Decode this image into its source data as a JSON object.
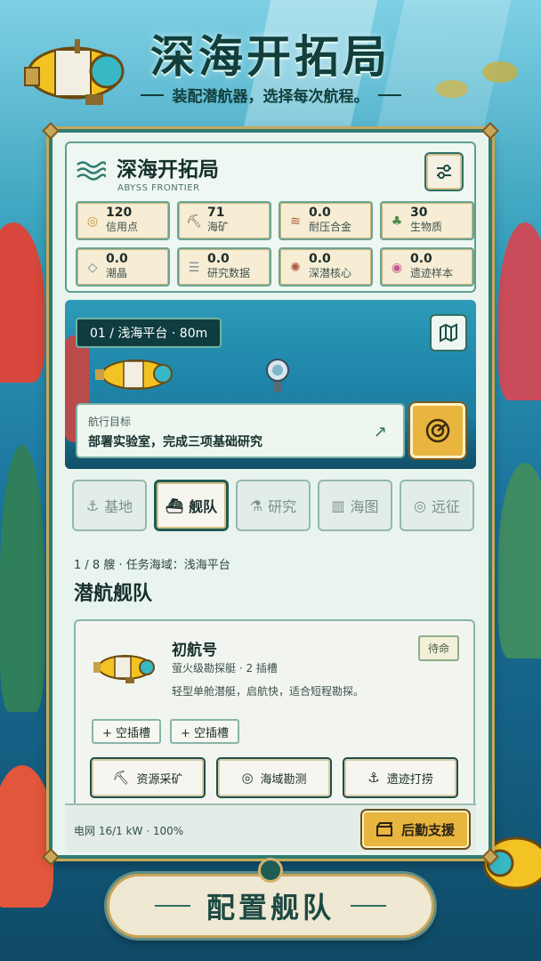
{
  "header": {
    "title": "深海开拓局",
    "subtitle": "装配潜航器，选择每次航程。"
  },
  "panel": {
    "title": "深海开拓局",
    "subtitle": "ABYSS FRONTIER",
    "settings_icon": "sliders-icon"
  },
  "resources": [
    {
      "value": "120",
      "label": "信用点",
      "icon": "coins-icon",
      "color": "#c8923a"
    },
    {
      "value": "71",
      "label": "海矿",
      "icon": "pickaxe-icon",
      "color": "#6b5a3a"
    },
    {
      "value": "0.0",
      "label": "耐压合金",
      "icon": "layers-icon",
      "color": "#b0563b"
    },
    {
      "value": "30",
      "label": "生物质",
      "icon": "sprout-icon",
      "color": "#4f8a48"
    },
    {
      "value": "0.0",
      "label": "潮晶",
      "icon": "gem-icon",
      "color": "#6f7f89"
    },
    {
      "value": "0.0",
      "label": "研究数据",
      "icon": "database-icon",
      "color": "#7a8b95"
    },
    {
      "value": "0.0",
      "label": "深潜核心",
      "icon": "atom-icon",
      "color": "#b0563b"
    },
    {
      "value": "0.0",
      "label": "遗迹样本",
      "icon": "disc-icon",
      "color": "#c25a8a"
    }
  ],
  "scene": {
    "depth": "01 / 浅海平台 · 80m",
    "objective_label": "航行目标",
    "objective_text": "部署实验室，完成三项基础研究"
  },
  "tabs": [
    {
      "label": "基地",
      "icon": "anchor-icon",
      "active": false
    },
    {
      "label": "舰队",
      "icon": "submarine-icon",
      "active": true
    },
    {
      "label": "研究",
      "icon": "flask-icon",
      "active": false
    },
    {
      "label": "海图",
      "icon": "map-icon",
      "active": false
    },
    {
      "label": "远征",
      "icon": "expedition-icon",
      "active": false
    }
  ],
  "fleet": {
    "meta": "1 / 8 艘 · 任务海域：浅海平台",
    "title": "潜航舰队",
    "ship": {
      "name": "初航号",
      "class": "萤火级勘探艇 · 2 插槽",
      "desc": "轻型单舱潜艇，启航快，适合短程勘探。",
      "status": "待命"
    },
    "slots": [
      "+ 空插槽",
      "+ 空插槽"
    ],
    "actions": [
      "资源采矿",
      "海域勘测",
      "遗迹打捞"
    ]
  },
  "footer": {
    "grid": "电网 16/1 kW · 100%",
    "support": "后勤支援"
  },
  "cta": {
    "label": "配置舰队"
  },
  "colors": {
    "accent": "#e8b53e",
    "frame": "#2f7c70",
    "text": "#17302d"
  }
}
